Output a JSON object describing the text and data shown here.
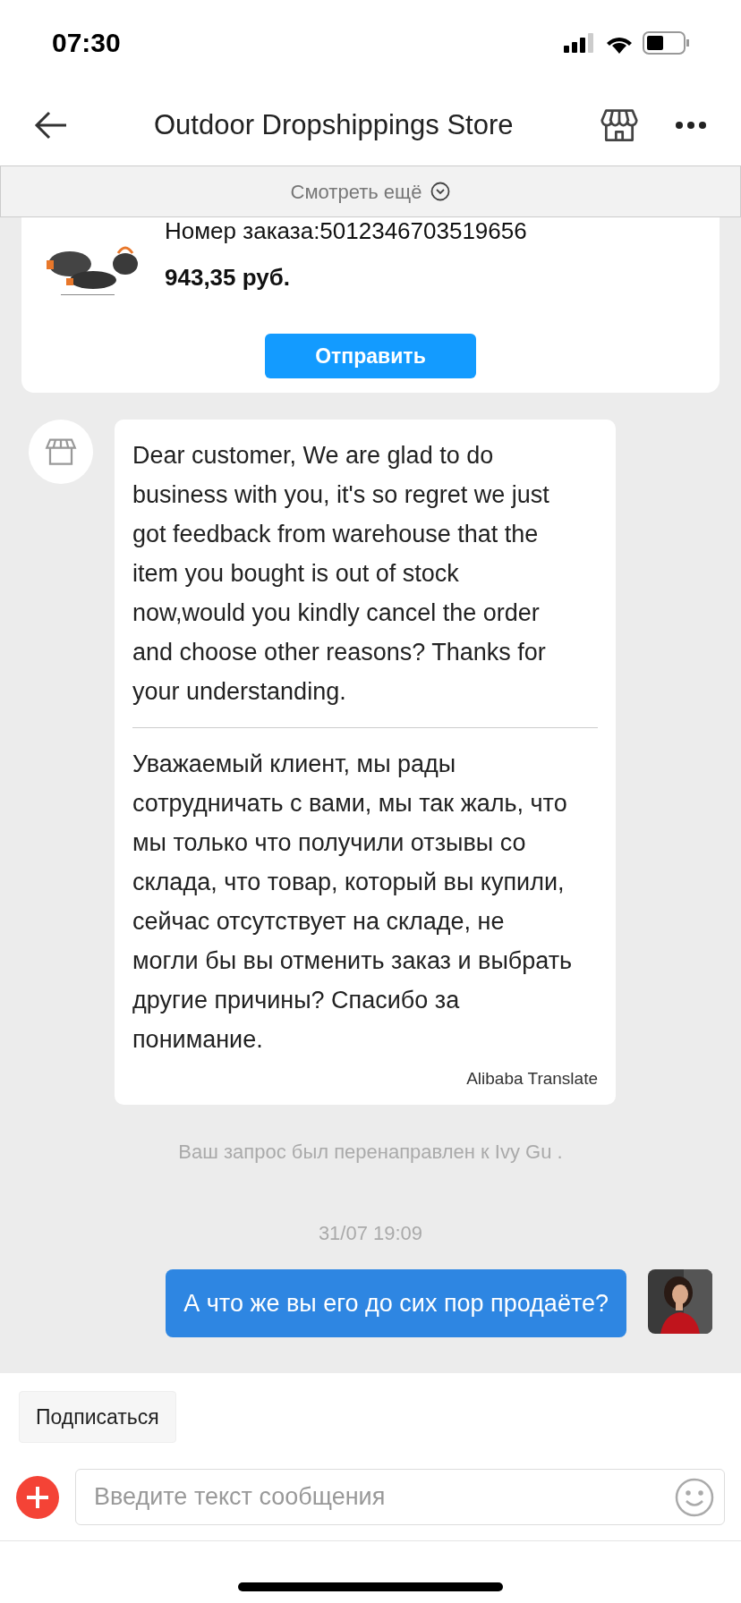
{
  "status_bar": {
    "time": "07:30"
  },
  "header": {
    "title": "Outdoor Dropshippings Store"
  },
  "see_more": {
    "label": "Смотреть ещё"
  },
  "order_card": {
    "order_number": "Номер заказа:5012346703519656",
    "price": "943,35 руб.",
    "button": "Отправить"
  },
  "messages": [
    {
      "kind": "incoming",
      "text": "Dear customer, We are glad to do business with you, it's so regret we just got feedback from warehouse that the item you bought is out of stock now,would you kindly cancel the order and choose other reasons? Thanks for your understanding.",
      "translation": "Уважаемый клиент, мы рады сотрудничать с вами, мы так жаль, что мы только что получили отзывы со склада, что товар, который вы купили, сейчас отсутствует на складе, не могли бы вы отменить заказ и выбрать другие причины? Спасибо за понимание.",
      "translator": "Alibaba Translate"
    },
    {
      "kind": "system",
      "text": "Ваш запрос был перенаправлен к Ivy Gu ."
    },
    {
      "kind": "timestamp",
      "text": "31/07 19:09"
    },
    {
      "kind": "outgoing",
      "text": "А что же вы его до сих пор продаёте?"
    }
  ],
  "subscribe_button": "Подписаться",
  "composer": {
    "placeholder": "Введите текст сообщения"
  }
}
